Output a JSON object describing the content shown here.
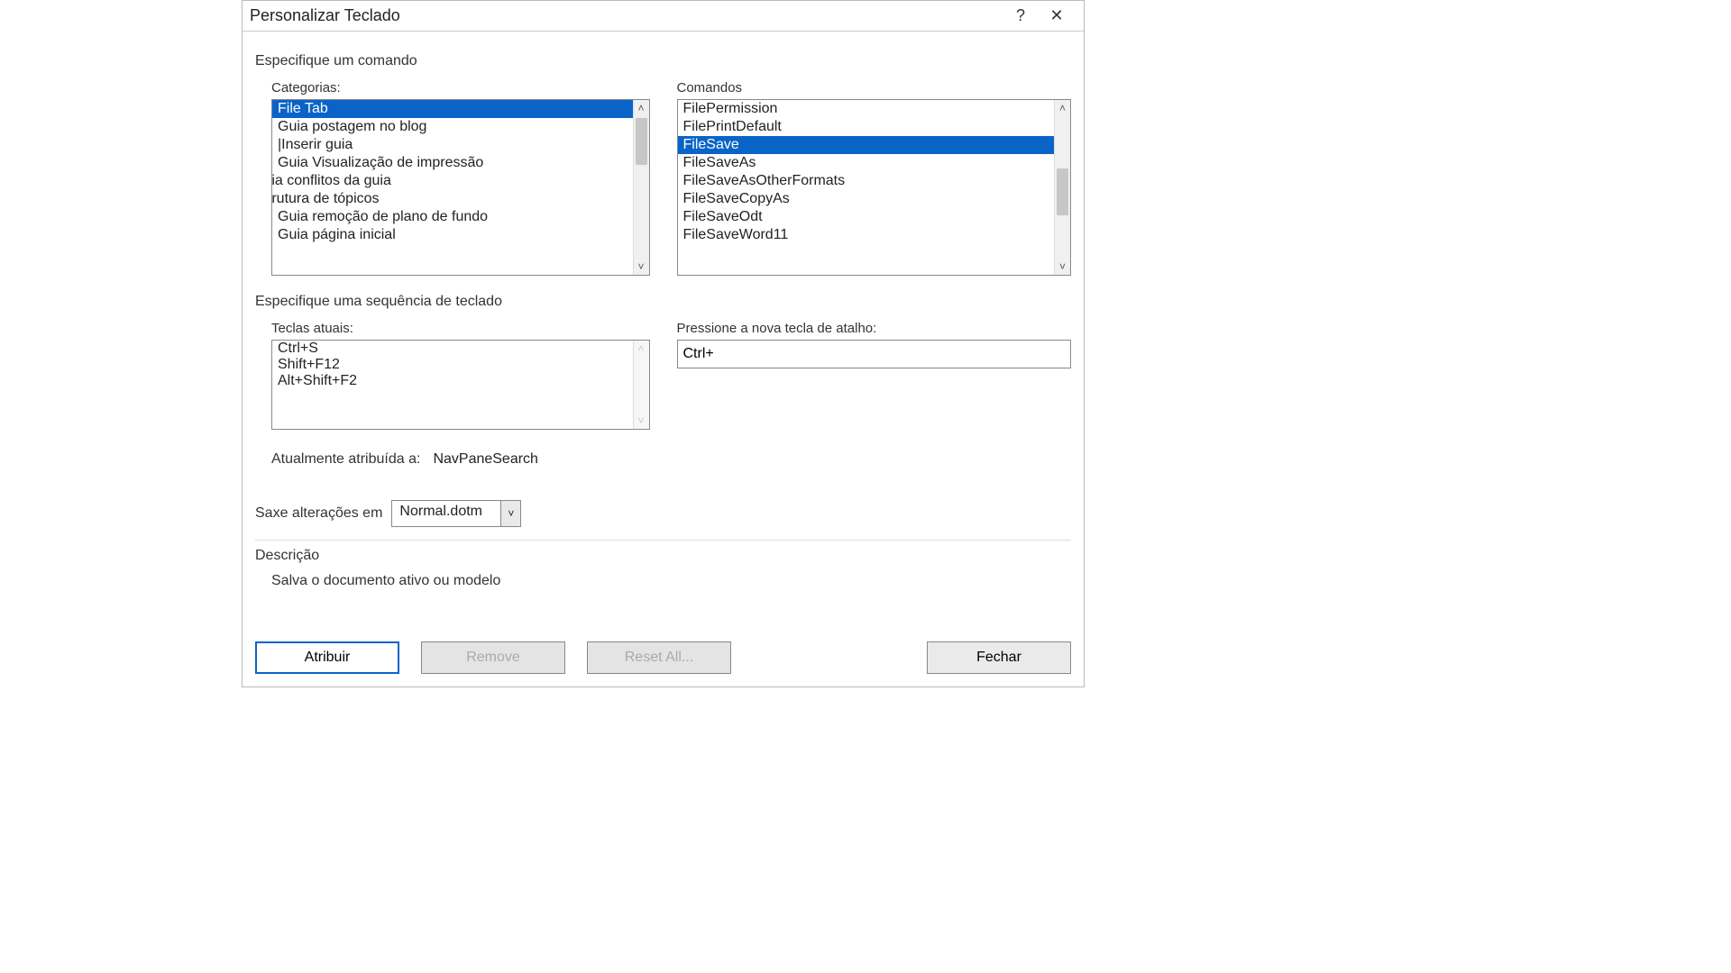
{
  "titlebar": {
    "title": "Personalizar Teclado",
    "help": "?",
    "close": "✕"
  },
  "labels": {
    "specify_command": "Especifique um comando",
    "categories": "Categorias:",
    "commands": "Comandos",
    "specify_sequence": "Especifique uma sequência de teclado",
    "current_keys": "Teclas atuais:",
    "press_new_key": "Pressione a nova tecla de atalho:",
    "currently_assigned": "Atualmente atribuída a:",
    "save_changes_in": "Saxe alterações em",
    "description": "Descrição"
  },
  "categories": {
    "items": [
      "File Tab",
      "Guia postagem no blog",
      "|Inserir guia",
      "Guia Visualização de impressão",
      "Guia conflitos da guia",
      "estrutura de tópicos",
      "Guia remoção de plano de fundo",
      "Guia página inicial"
    ],
    "selected_index": 0
  },
  "commands": {
    "items": [
      "FilePermission",
      "FilePrintDefault",
      "FileSave",
      "FileSaveAs",
      "FileSaveAsOtherFormats",
      "FileSaveCopyAs",
      "FileSaveOdt",
      "FileSaveWord11"
    ],
    "selected_index": 2
  },
  "current_keys": {
    "items": [
      "Ctrl+S",
      "Shift+F12",
      "Alt+Shift+F2"
    ]
  },
  "new_key_input": {
    "value": "Ctrl+"
  },
  "currently_assigned_to": "NavPaneSearch",
  "save_in": {
    "value": "Normal.dotm"
  },
  "description_text": "Salva o documento ativo ou modelo",
  "buttons": {
    "assign": "Atribuir",
    "remove": "Remove",
    "reset_all": "Reset All...",
    "close": "Fechar"
  }
}
